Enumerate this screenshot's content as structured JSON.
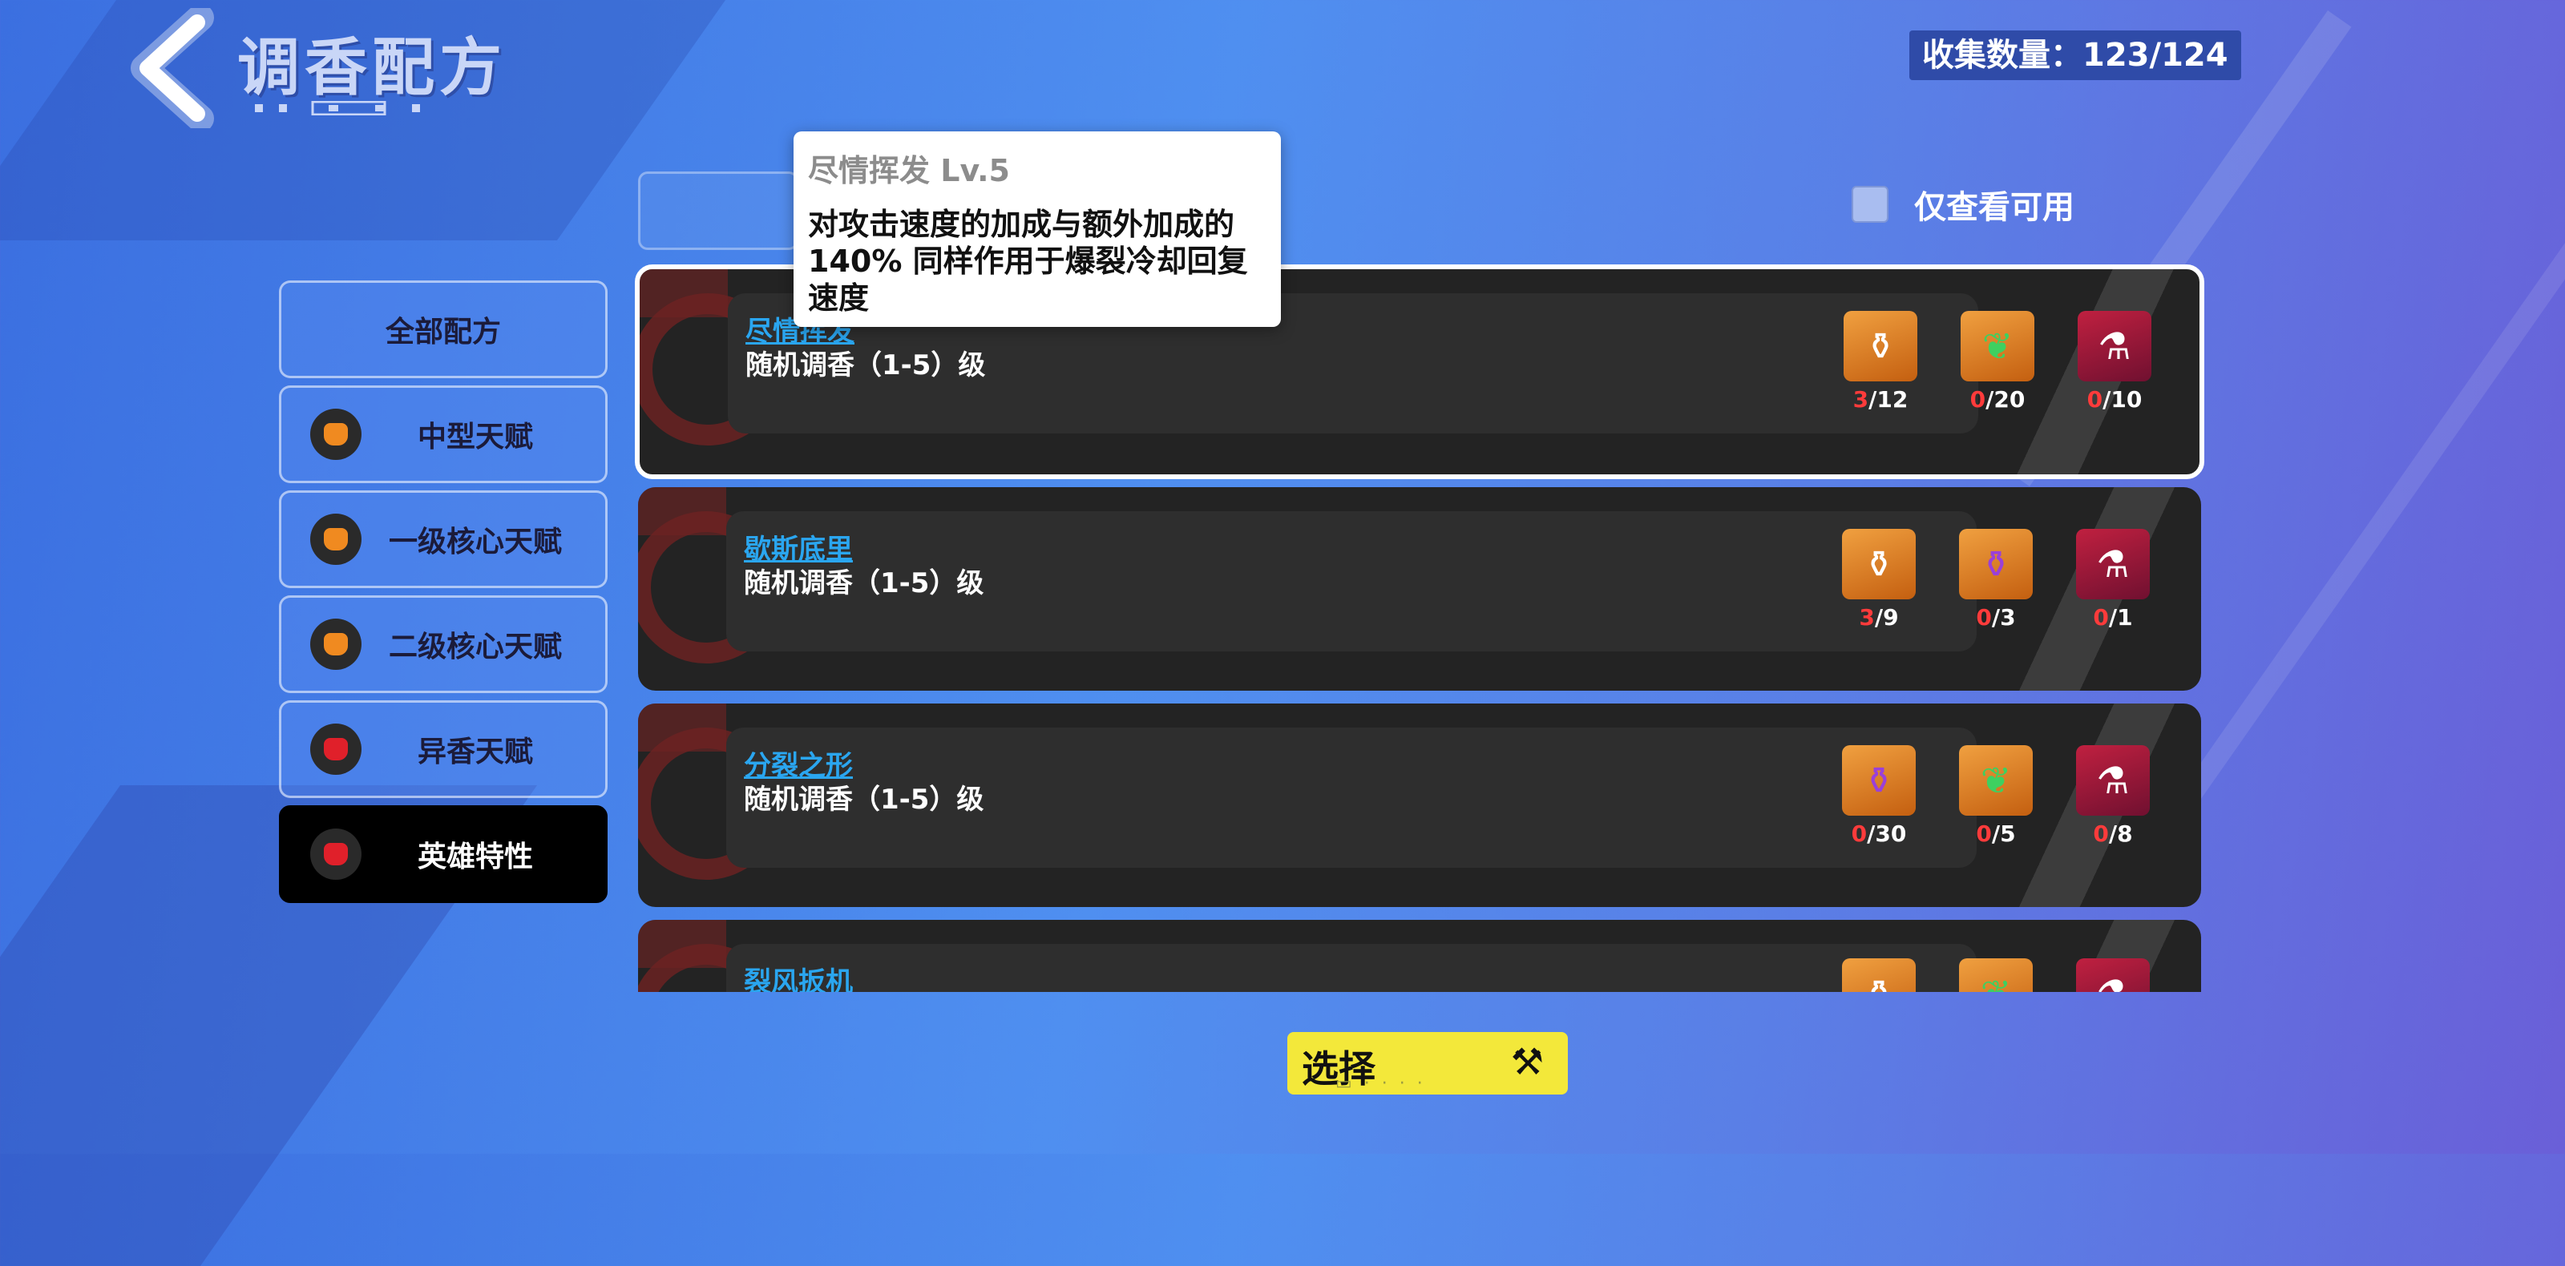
{
  "header": {
    "title": "调香配方",
    "collection": "收集数量：123/124"
  },
  "filter": {
    "only_available_label": "仅查看可用"
  },
  "sidebar": {
    "items": [
      {
        "label": "全部配方",
        "icon": "none",
        "color": ""
      },
      {
        "label": "中型天赋",
        "icon": "orange-pot-icon",
        "color": "#f08a20"
      },
      {
        "label": "一级核心天赋",
        "icon": "orange-pot-icon",
        "color": "#f08a20"
      },
      {
        "label": "二级核心天赋",
        "icon": "orange-pot-icon",
        "color": "#f08a20"
      },
      {
        "label": "异香天赋",
        "icon": "red-pot-icon",
        "color": "#e0202a"
      },
      {
        "label": "英雄特性",
        "icon": "red-pot-icon",
        "color": "#e0202a",
        "active": true
      }
    ]
  },
  "tooltip": {
    "title": "尽情挥发 Lv.5",
    "description": "对攻击速度的加成与额外加成的140% 同样作用于爆裂冷却回复速度"
  },
  "recipes": [
    {
      "name": "尽情挥发",
      "sub": "随机调香（1-5）级",
      "selected": true,
      "ingredients": [
        {
          "icon": "orange-flask-icon",
          "have": "3",
          "need": "/12"
        },
        {
          "icon": "green-pot-icon",
          "have": "0",
          "need": "/20"
        },
        {
          "icon": "crystal-flask-icon",
          "have": "0",
          "need": "/10"
        }
      ]
    },
    {
      "name": "歇斯底里",
      "sub": "随机调香（1-5）级",
      "ingredients": [
        {
          "icon": "orange-flask-icon",
          "have": "3",
          "need": "/9"
        },
        {
          "icon": "purple-flask-icon",
          "have": "0",
          "need": "/3"
        },
        {
          "icon": "crystal-flask-icon",
          "have": "0",
          "need": "/1"
        }
      ]
    },
    {
      "name": "分裂之形",
      "sub": "随机调香（1-5）级",
      "ingredients": [
        {
          "icon": "purple-flask-icon",
          "have": "0",
          "need": "/30"
        },
        {
          "icon": "green-pot-icon",
          "have": "0",
          "need": "/5"
        },
        {
          "icon": "crystal-flask-icon",
          "have": "0",
          "need": "/8"
        }
      ]
    },
    {
      "name": "裂风扳机",
      "sub": "",
      "ingredients": []
    }
  ],
  "select_button": {
    "label": "选择"
  }
}
